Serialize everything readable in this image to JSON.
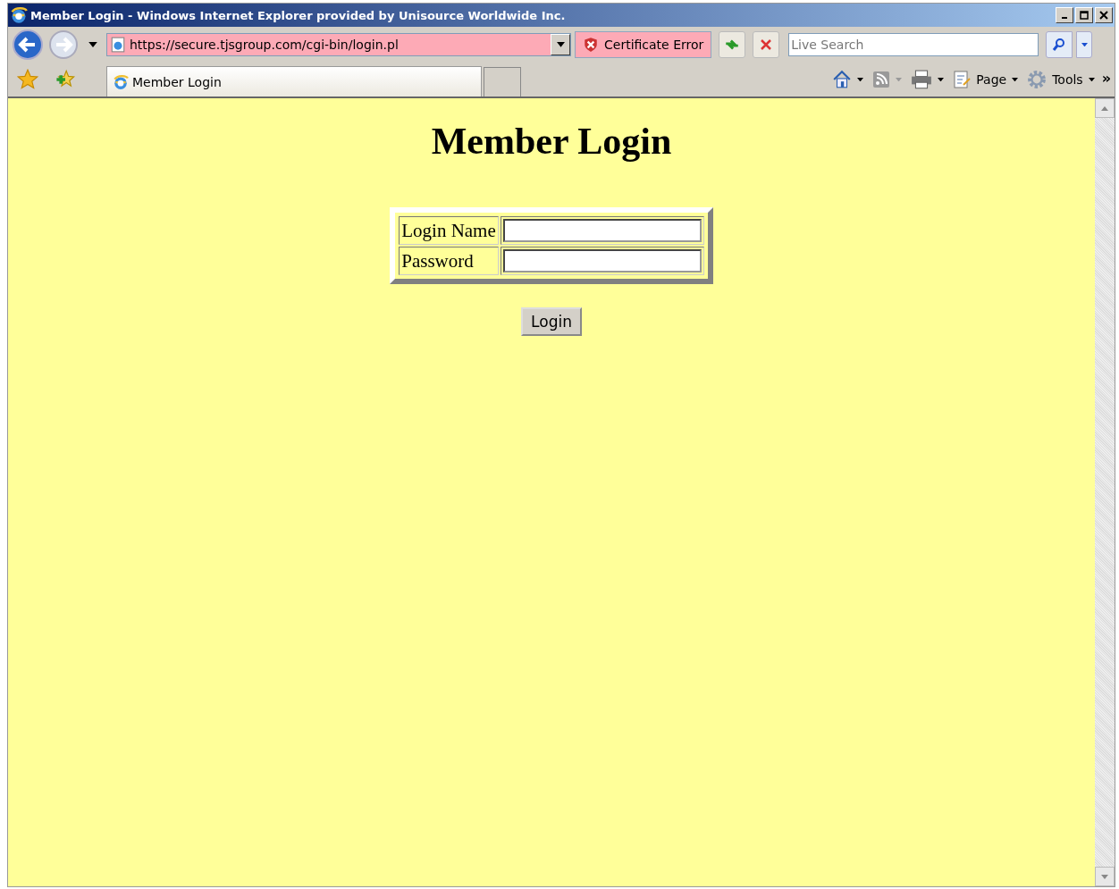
{
  "window": {
    "title": "Member Login - Windows Internet Explorer provided by Unisource Worldwide Inc."
  },
  "address_bar": {
    "url": "https://secure.tjsgroup.com/cgi-bin/login.pl",
    "certificate_error": "Certificate Error"
  },
  "search": {
    "placeholder": "Live Search"
  },
  "tabs": [
    {
      "label": "Member Login",
      "selected": true
    }
  ],
  "command_bar": {
    "items": [
      {
        "kind": "home"
      },
      {
        "kind": "feeds",
        "disabled": true
      },
      {
        "kind": "print"
      },
      {
        "kind": "page",
        "label": "Page"
      },
      {
        "kind": "tools",
        "label": "Tools"
      }
    ],
    "overflow": "»"
  },
  "page": {
    "heading": "Member Login",
    "fields": [
      {
        "label": "Login Name"
      },
      {
        "label": "Password"
      }
    ],
    "submit": "Login"
  }
}
